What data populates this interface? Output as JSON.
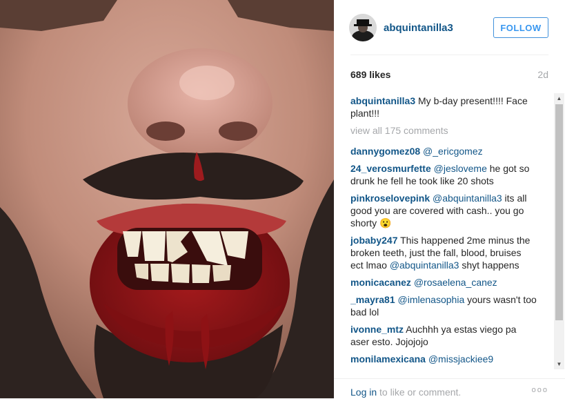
{
  "post": {
    "username": "abquintanilla3",
    "follow_label": "FOLLOW",
    "likes": "689 likes",
    "time": "2d",
    "caption_user": "abquintanilla3",
    "caption_text": " My b-day present!!!! Face plant!!!",
    "view_all": "view all 175 comments"
  },
  "comments": [
    {
      "user": "dannygomez08",
      "parts": [
        {
          "t": " "
        },
        {
          "m": "@_ericgomez"
        }
      ]
    },
    {
      "user": "24_verosmurfette",
      "parts": [
        {
          "t": " "
        },
        {
          "m": "@jesloveme"
        },
        {
          "t": " he got so drunk he fell he took like 20 shots"
        }
      ]
    },
    {
      "user": "pinkroselovepink",
      "parts": [
        {
          "t": " "
        },
        {
          "m": "@abquintanilla3"
        },
        {
          "t": " its all good you are covered with cash.. you go shorty 😮"
        }
      ]
    },
    {
      "user": "jobaby247",
      "parts": [
        {
          "t": " This happened 2me minus the broken teeth, just the fall, blood, bruises ect lmao "
        },
        {
          "m": "@abquintanilla3"
        },
        {
          "t": " shyt happens"
        }
      ]
    },
    {
      "user": "monicacanez",
      "parts": [
        {
          "t": " "
        },
        {
          "m": "@rosaelena_canez"
        }
      ]
    },
    {
      "user": "_mayra81",
      "parts": [
        {
          "t": " "
        },
        {
          "m": "@imlenasophia"
        },
        {
          "t": " yours wasn't too bad lol"
        }
      ]
    },
    {
      "user": "ivonne_mtz",
      "parts": [
        {
          "t": " Auchhh ya estas viego pa aser esto. Jojojojo"
        }
      ]
    },
    {
      "user": "monilamexicana",
      "parts": [
        {
          "t": " "
        },
        {
          "m": "@missjackiee9"
        }
      ]
    }
  ],
  "footer": {
    "login_link": "Log in",
    "login_rest": " to like or comment.",
    "more": "ooo"
  },
  "icons": {
    "scroll_up": "scroll-up-arrow-icon",
    "scroll_down": "scroll-down-arrow-icon",
    "more": "more-options-icon"
  },
  "colors": {
    "link": "#125688",
    "follow": "#3897f0",
    "muted": "#a5a7aa"
  }
}
